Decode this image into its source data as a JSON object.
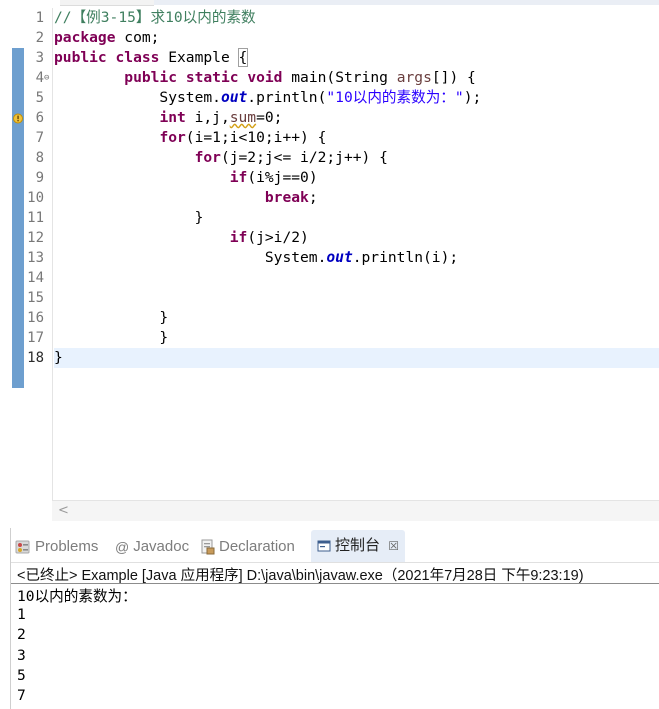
{
  "editor": {
    "line_numbers": [
      "1",
      "2",
      "3",
      "4",
      "5",
      "6",
      "7",
      "8",
      "9",
      "10",
      "11",
      "12",
      "13",
      "14",
      "15",
      "16",
      "17",
      "18"
    ],
    "lines": {
      "l1_comment": "//【例3-15】求10以内的素数",
      "l2_kw": "package",
      "l2_rest": " com;",
      "l3_kw1": "public",
      "l3_kw2": "class",
      "l3_rest": " Example ",
      "l3_brace": "{",
      "l4_indent": "        ",
      "l4_kw1": "public",
      "l4_kw2": "static",
      "l4_kw3": "void",
      "l4_rest1": " main(String ",
      "l4_param": "args",
      "l4_rest2": "[]) {",
      "l5_indent": "            System.",
      "l5_field": "out",
      "l5_rest": ".println(",
      "l5_string": "\"10以内的素数为：\"",
      "l5_end": ");",
      "l6_indent": "            ",
      "l6_kw": "int",
      "l6_rest1": " i,j,",
      "l6_unused": "sum",
      "l6_rest2": "=0;",
      "l7_indent": "            ",
      "l7_kw": "for",
      "l7_rest": "(i=1;i<10;i++) {",
      "l8_indent": "                ",
      "l8_kw": "for",
      "l8_rest": "(j=2;j<= i/2;j++) {",
      "l9_indent": "                    ",
      "l9_kw": "if",
      "l9_rest": "(i%j==0)",
      "l10_indent": "                        ",
      "l10_kw": "break",
      "l10_rest": ";",
      "l11_text": "                }",
      "l12_indent": "                    ",
      "l12_kw": "if",
      "l12_rest": "(j>i/2)",
      "l13_indent": "                        System.",
      "l13_field": "out",
      "l13_rest": ".println(i);",
      "l16_text": "            }",
      "l17_text": "            }",
      "l18_text": "}"
    }
  },
  "views": {
    "tabs": [
      {
        "label": "Problems",
        "icon": "problems-icon"
      },
      {
        "label": "Javadoc",
        "icon": "at-icon"
      },
      {
        "label": "Declaration",
        "icon": "declaration-icon"
      },
      {
        "label": "控制台",
        "icon": "console-icon",
        "active": true
      }
    ],
    "close_glyph": "☒",
    "console": {
      "status": "<已终止> Example [Java 应用程序] D:\\java\\bin\\javaw.exe（2021年7月28日 下午9:23:19)",
      "output_lines": [
        "10以内的素数为：",
        "1",
        "2",
        "3",
        "5",
        "7"
      ]
    }
  },
  "colors": {
    "keyword": "#7f0055",
    "comment": "#3f7f5f",
    "string": "#2a00ff",
    "static_field": "#0000c0",
    "current_line": "#e8f2fe",
    "active_tab": "#e6edf7"
  }
}
